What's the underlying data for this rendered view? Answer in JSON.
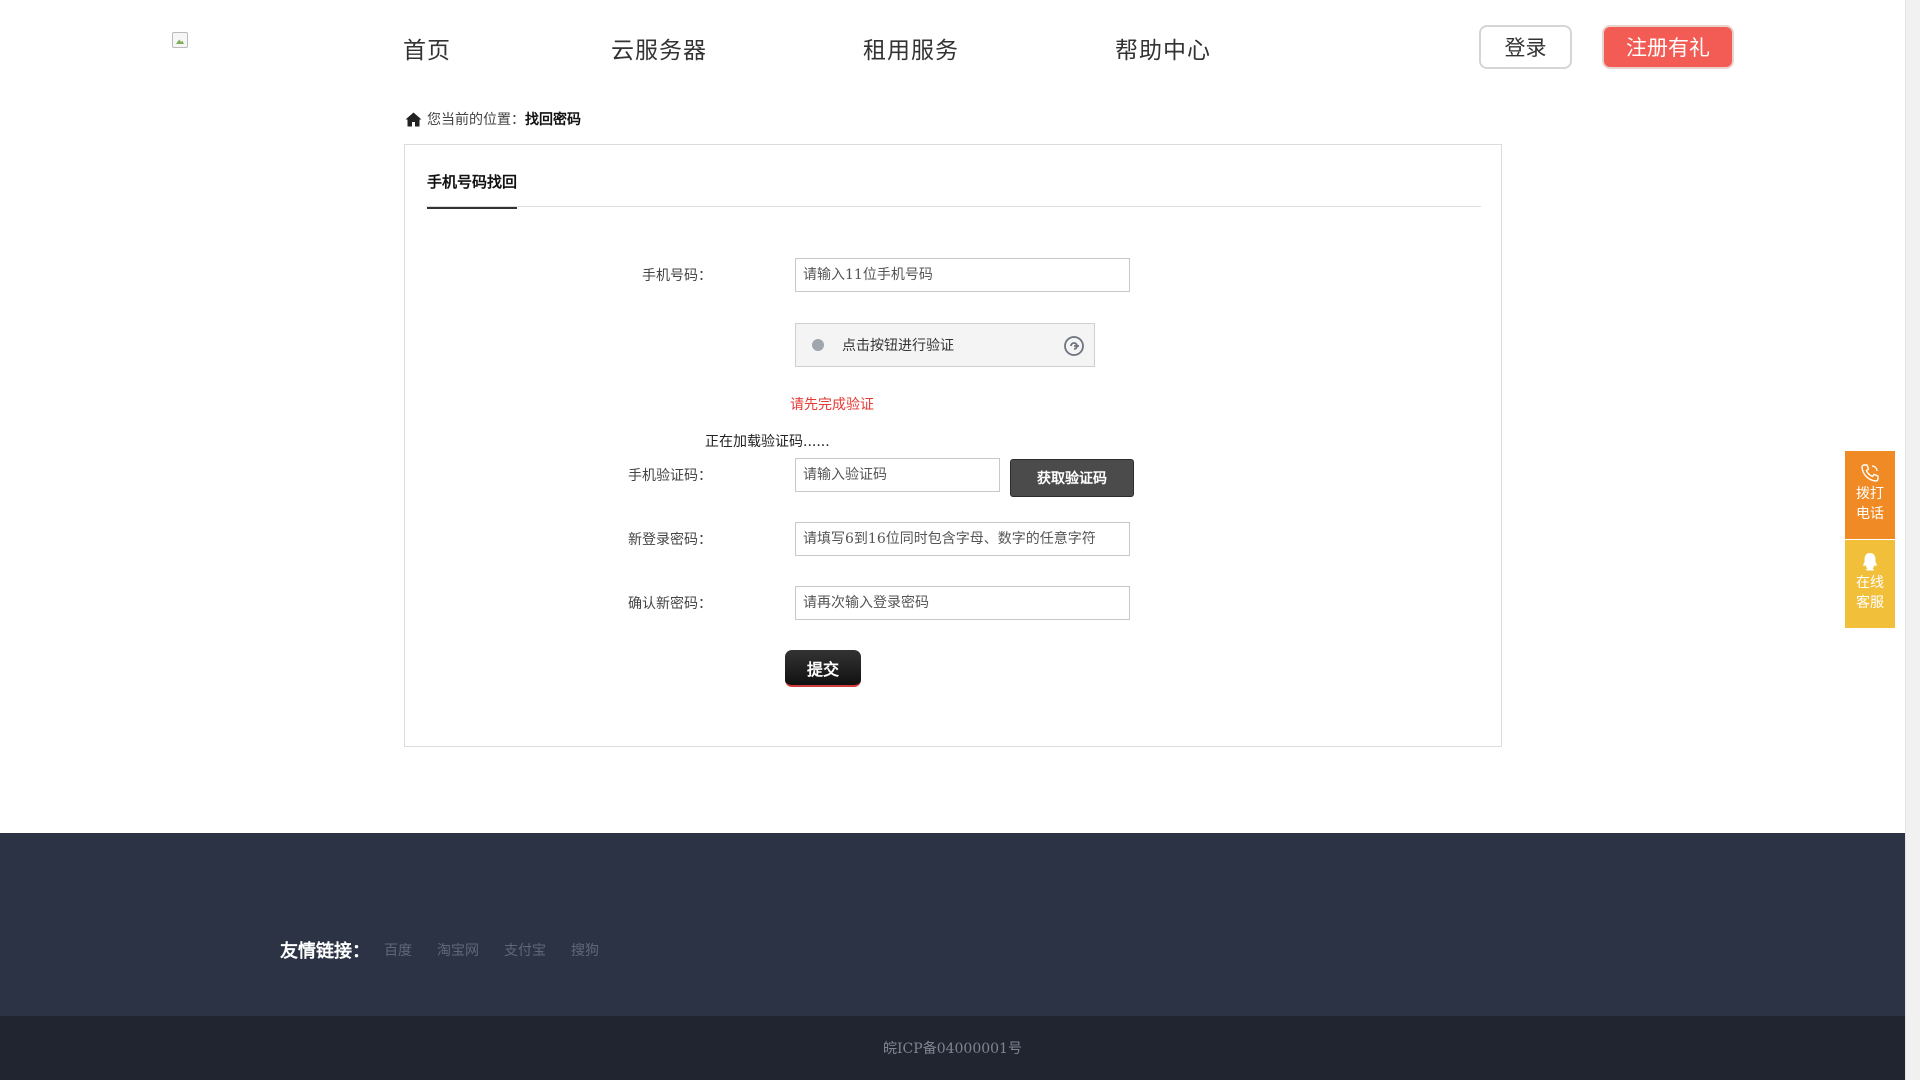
{
  "nav": {
    "items": [
      "首页",
      "云服务器",
      "租用服务",
      "帮助中心"
    ],
    "login_label": "登录",
    "register_label": "注册有礼"
  },
  "breadcrumb": {
    "prefix": "您当前的位置：",
    "current": "找回密码"
  },
  "form": {
    "tab_label": "手机号码找回",
    "phone_label": "手机号码：",
    "phone_placeholder": "请输入11位手机号码",
    "captcha_text": "点击按钮进行验证",
    "captcha_error": "请先完成验证",
    "loading_text": "正在加载验证码......",
    "sms_label": "手机验证码：",
    "sms_placeholder": "请输入验证码",
    "get_code_label": "获取验证码",
    "new_password_label": "新登录密码：",
    "new_password_placeholder": "请填写6到16位同时包含字母、数字的任意字符",
    "confirm_password_label": "确认新密码：",
    "confirm_password_placeholder": "请再次输入登录密码",
    "submit_label": "提交"
  },
  "footer": {
    "links_title": "友情链接：",
    "links": [
      "百度",
      "淘宝网",
      "支付宝",
      "搜狗"
    ],
    "icp": "皖ICP备04000001号"
  },
  "side": {
    "call_line1": "拨打",
    "call_line2": "电话",
    "service_line1": "在线",
    "service_line2": "客服"
  },
  "colors": {
    "register_bg": "#f25c54",
    "error_text": "#e53935",
    "footer_bg": "#2b3344",
    "footer_bottom_bg": "#20252f",
    "side_call": "#f08a24",
    "side_service": "#f2bf3b"
  },
  "icons": [
    "home-icon",
    "refresh-icon",
    "phone-icon",
    "qq-icon",
    "logo-image"
  ]
}
